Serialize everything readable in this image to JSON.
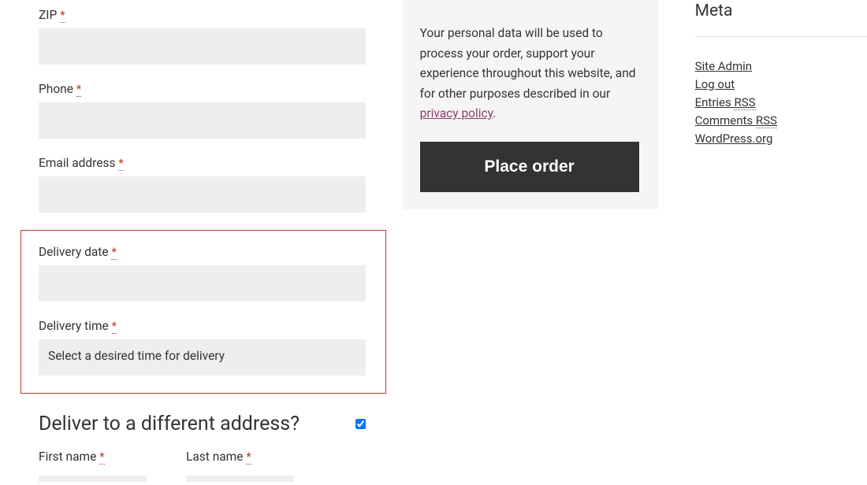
{
  "form": {
    "zip": {
      "label": "ZIP ",
      "required": "*"
    },
    "phone": {
      "label": "Phone ",
      "required": "*"
    },
    "email": {
      "label": "Email address ",
      "required": "*"
    },
    "delivery_date": {
      "label": "Delivery date ",
      "required": "*"
    },
    "delivery_time": {
      "label": "Delivery time ",
      "required": "*",
      "placeholder": "Select a desired time for delivery"
    },
    "ship_different": {
      "heading": "Deliver to a different address?"
    },
    "first_name": {
      "label": "First name ",
      "required": "*"
    },
    "last_name": {
      "label": "Last name ",
      "required": "*"
    }
  },
  "order": {
    "privacy_text_before": "Your personal data will be used to process your order, support your experience throughout this website, and for other purposes described in our ",
    "privacy_link_text": "privacy policy",
    "privacy_text_after": ".",
    "button_label": "Place order"
  },
  "meta": {
    "heading": "Meta",
    "links": {
      "site_admin": "Site Admin",
      "logout": "Log out",
      "entries": "Entries ",
      "entries_rss": "RSS",
      "comments": "Comments ",
      "comments_rss": "RSS",
      "wordpress": "WordPress.org"
    }
  }
}
